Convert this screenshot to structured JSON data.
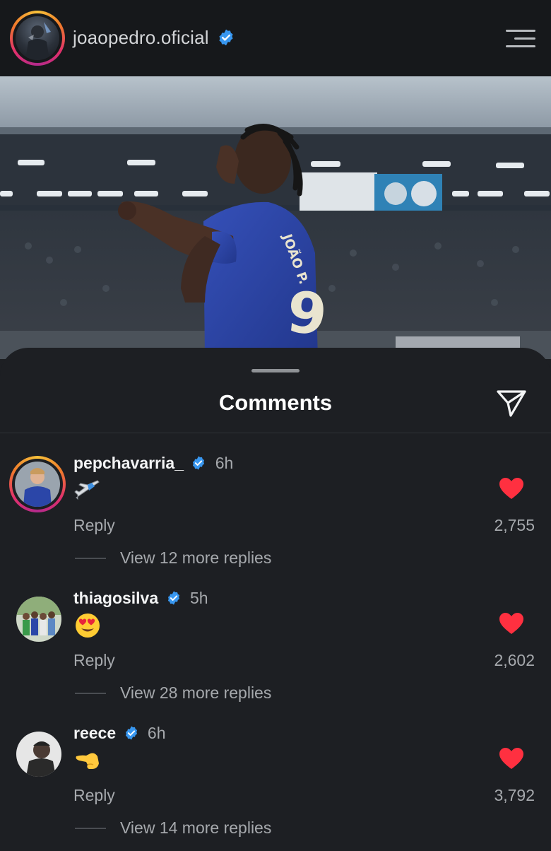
{
  "header": {
    "username": "joaopedro.oficial",
    "verified": true
  },
  "comments_sheet": {
    "title": "Comments",
    "comments": [
      {
        "username": "pepchavarria_",
        "time": "6h",
        "emoji": "airplane",
        "reply_label": "Reply",
        "likes": "2,755",
        "view_replies": "View 12 more replies"
      },
      {
        "username": "thiagosilva",
        "time": "5h",
        "emoji": "heart-eyes",
        "reply_label": "Reply",
        "likes": "2,602",
        "view_replies": "View 28 more replies"
      },
      {
        "username": "reece",
        "time": "6h",
        "emoji": "pointing-left-hand",
        "reply_label": "Reply",
        "likes": "3,792",
        "view_replies": "View 14 more replies"
      }
    ]
  },
  "colors": {
    "background": "#1d1f23",
    "header_background": "#16181b",
    "verified_blue": "#3897f0",
    "like_red": "#ff3040",
    "secondary_text": "#a6a9ad",
    "jersey_blue": "#2b46a8"
  }
}
